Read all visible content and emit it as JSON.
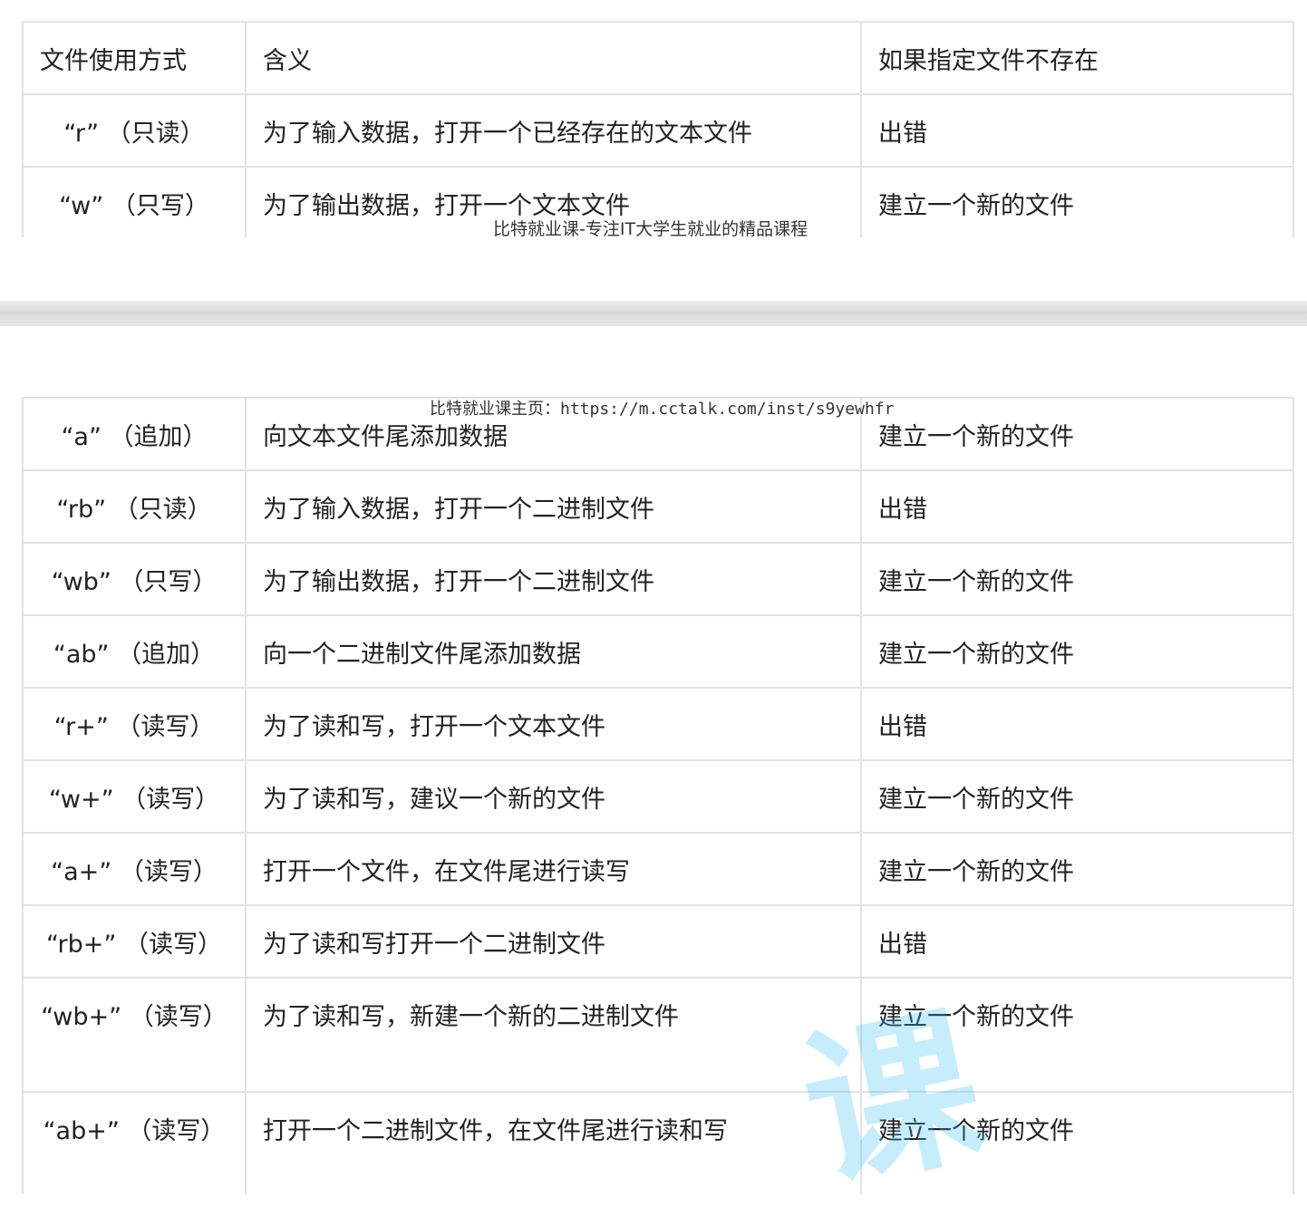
{
  "table": {
    "headers": [
      "文件使用方式",
      "含义",
      "如果指定文件不存在"
    ],
    "rows_top": [
      {
        "mode": "“r” （只读）",
        "meaning": "为了输入数据，打开一个已经存在的文本文件",
        "if_missing": "出错"
      },
      {
        "mode": "“w” （只写）",
        "meaning": "为了输出数据，打开一个文本文件",
        "if_missing": "建立一个新的文件"
      }
    ],
    "rows_bottom": [
      {
        "mode": "“a” （追加）",
        "meaning": "向文本文件尾添加数据",
        "if_missing": "建立一个新的文件"
      },
      {
        "mode": "“rb” （只读）",
        "meaning": "为了输入数据，打开一个二进制文件",
        "if_missing": "出错"
      },
      {
        "mode": "“wb” （只写）",
        "meaning": "为了输出数据，打开一个二进制文件",
        "if_missing": "建立一个新的文件"
      },
      {
        "mode": "“ab” （追加）",
        "meaning": "向一个二进制文件尾添加数据",
        "if_missing": "建立一个新的文件"
      },
      {
        "mode": "“r+” （读写）",
        "meaning": "为了读和写，打开一个文本文件",
        "if_missing": "出错"
      },
      {
        "mode": "“w+” （读写）",
        "meaning": "为了读和写，建议一个新的文件",
        "if_missing": "建立一个新的文件"
      },
      {
        "mode": "“a+” （读写）",
        "meaning": "打开一个文件，在文件尾进行读写",
        "if_missing": "建立一个新的文件"
      },
      {
        "mode": "“rb+” （读写）",
        "meaning": "为了读和写打开一个二进制文件",
        "if_missing": "出错"
      },
      {
        "mode": "“wb+” （读写）",
        "meaning": "为了读和写，新建一个新的二进制文件",
        "if_missing": "建立一个新的文件"
      },
      {
        "mode": "“ab+” （读写）",
        "meaning": "打开一个二进制文件，在文件尾进行读和写",
        "if_missing": "建立一个新的文件"
      }
    ]
  },
  "watermarks": {
    "line1": "比特就业课-专注IT大学生就业的精品课程",
    "line2": "比特就业课主页：https://m.cctalk.com/inst/s9yewhfr",
    "big": "课"
  }
}
